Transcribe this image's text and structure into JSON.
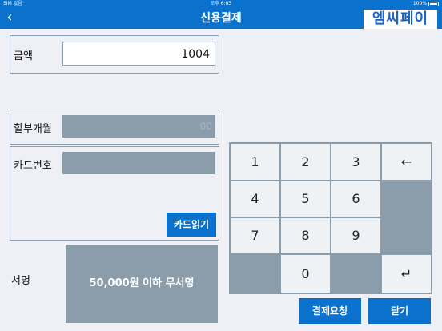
{
  "status_bar": {
    "carrier": "SIM 없음",
    "time": "오후 6:03",
    "battery": "100%"
  },
  "nav": {
    "title": "신용결제",
    "logo_text": "엠씨페이"
  },
  "form": {
    "amount_label": "금액",
    "amount_value": "1004",
    "installment_label": "할부개월",
    "installment_placeholder": "00",
    "card_number_label": "카드번호",
    "read_card_button": "카드읽기",
    "signature_label": "서명",
    "signature_text": "50,000원 이하 무서명"
  },
  "keypad": {
    "keys": [
      "1",
      "2",
      "3",
      "←",
      "4",
      "5",
      "6",
      "",
      "7",
      "8",
      "9",
      "",
      "",
      "0",
      "",
      "↵"
    ]
  },
  "actions": {
    "request_payment": "결제요청",
    "close": "닫기"
  },
  "colors": {
    "accent": "#0a72cc",
    "field_gray": "#8b9dab",
    "background": "#eef0f6"
  }
}
